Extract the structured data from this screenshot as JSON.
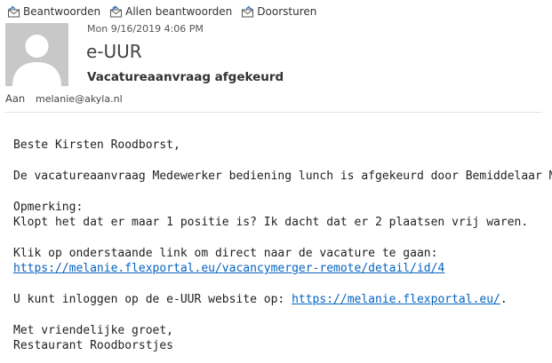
{
  "toolbar": {
    "reply_label": "Beantwoorden",
    "reply_all_label": "Allen beantwoorden",
    "forward_label": "Doorsturen"
  },
  "header": {
    "date": "Mon 9/16/2019 4:06 PM",
    "sender": "e-UUR",
    "subject": "Vacatureaanvraag afgekeurd",
    "to_label": "Aan",
    "to_value": "melanie@akyla.nl"
  },
  "body": {
    "greeting": "Beste Kirsten Roodborst,",
    "line1": "De vacatureaanvraag Medewerker bediening lunch is afgekeurd door Bemiddelaar MD.",
    "remark_label": "Opmerking:",
    "remark_text": "Klopt het dat er maar 1 positie is? Ik dacht dat er 2 plaatsen vrij waren.",
    "link_intro": "Klik op onderstaande link om direct naar de vacature te gaan:",
    "vacancy_link": "https://melanie.flexportal.eu/vacancymerger-remote/detail/id/4",
    "login_prefix": "U kunt inloggen op de e-UUR website op: ",
    "login_link": "https://melanie.flexportal.eu/",
    "login_suffix": ".",
    "closing": "Met vriendelijke groet,",
    "signature": "Restaurant Roodborstjes"
  },
  "colors": {
    "link": "#0563c1",
    "avatar_bg": "#c8c8c8",
    "avatar_fg": "#ffffff"
  },
  "icons": [
    "reply-icon",
    "reply-all-icon",
    "forward-icon",
    "avatar-person-icon"
  ]
}
